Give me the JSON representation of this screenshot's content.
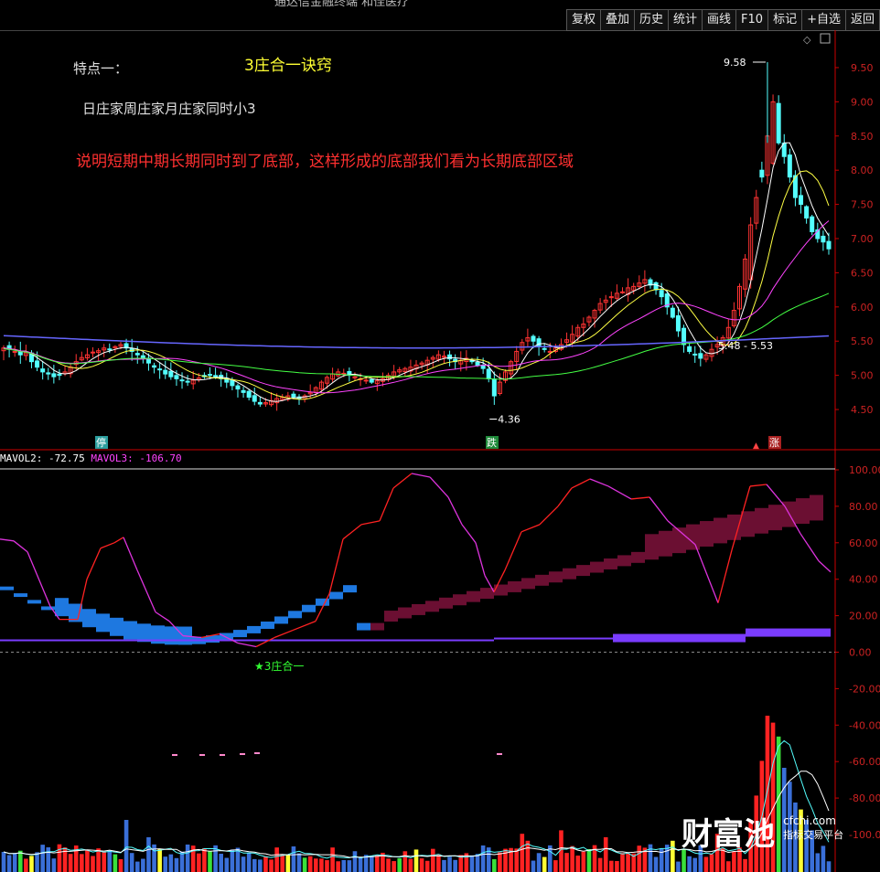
{
  "toolbar": {
    "title": "通达信金融终端 和佳医疗",
    "buttons": [
      "复权",
      "叠加",
      "历史",
      "统计",
      "画线",
      "F10",
      "标记",
      "+自选",
      "返回"
    ]
  },
  "annotations": {
    "feature_label": "特点一：",
    "method_title": "3庄合一诀窍",
    "condition_text": "日庄家周庄家月庄家同时小3",
    "explanation_text": "说明短期中期长期同时到了底部，这样形成的底部我们看为长期底部区域",
    "signal_label": "★3庄合一"
  },
  "price_panel": {
    "high_label": "9.58",
    "low_label": "4.36",
    "range_label": "5.48 - 5.53",
    "markers": [
      "停",
      "跌",
      "涨"
    ]
  },
  "indicator_panel": {
    "legend": [
      {
        "text": "MAVOL2: -72.75",
        "color": "#ffffff"
      },
      {
        "text": "MAVOL3: -106.70",
        "color": "#ff44ff"
      }
    ]
  },
  "watermark": {
    "brand": "财富池",
    "domain": "cfchi.com",
    "tagline": "指标交易平台"
  },
  "colors": {
    "up": "#ff3333",
    "down": "#54ffff",
    "ma5": "#ffffff",
    "ma10": "#ffff44",
    "ma20": "#ff44ff",
    "ma60": "#44ff44",
    "ma120": "#6666ff",
    "axis": "#cc0000",
    "band_low": "#1e78e0",
    "band_high": "#6b0f32",
    "bar_purple": "#7a3cff"
  },
  "chart_data": [
    {
      "type": "candlestick",
      "title": "",
      "ylim": [
        4.3,
        9.7
      ],
      "y_ticks": [
        "9.50",
        "9.00",
        "8.50",
        "8.00",
        "7.50",
        "7.00",
        "6.50",
        "6.00",
        "5.50",
        "5.00",
        "4.50"
      ],
      "close": [
        5.4,
        5.38,
        5.35,
        5.3,
        5.33,
        5.2,
        5.12,
        5.05,
        5.02,
        4.98,
        5.0,
        5.05,
        5.12,
        5.2,
        5.26,
        5.3,
        5.34,
        5.36,
        5.4,
        5.38,
        5.42,
        5.45,
        5.4,
        5.35,
        5.3,
        5.25,
        5.18,
        5.12,
        5.08,
        5.02,
        4.98,
        4.95,
        4.92,
        4.9,
        4.93,
        4.96,
        4.98,
        5.0,
        4.98,
        4.95,
        4.9,
        4.85,
        4.8,
        4.75,
        4.68,
        4.62,
        4.58,
        4.6,
        4.63,
        4.66,
        4.68,
        4.7,
        4.68,
        4.66,
        4.7,
        4.75,
        4.82,
        4.9,
        4.97,
        5.02,
        5.05,
        5.03,
        5.0,
        4.98,
        4.95,
        4.93,
        4.9,
        4.92,
        4.95,
        5.0,
        5.05,
        5.08,
        5.1,
        5.12,
        5.15,
        5.18,
        5.22,
        5.26,
        5.3,
        5.28,
        5.24,
        5.2,
        5.22,
        5.25,
        5.2,
        5.15,
        5.1,
        4.95,
        4.7,
        4.9,
        5.05,
        5.2,
        5.35,
        5.48,
        5.55,
        5.5,
        5.42,
        5.38,
        5.35,
        5.4,
        5.45,
        5.52,
        5.6,
        5.7,
        5.75,
        5.85,
        5.95,
        6.05,
        6.1,
        6.15,
        6.2,
        6.22,
        6.28,
        6.3,
        6.35,
        6.4,
        6.32,
        6.25,
        6.15,
        6.0,
        5.85,
        5.65,
        5.45,
        5.35,
        5.3,
        5.25,
        5.3,
        5.38,
        5.45,
        5.55,
        5.7,
        5.95,
        6.3,
        6.7,
        7.2,
        7.6,
        7.9,
        8.5,
        9.0,
        8.4,
        8.2,
        7.9,
        7.6,
        7.5,
        7.3,
        7.1,
        7.0,
        6.95,
        6.85
      ]
    },
    {
      "type": "line",
      "title": "",
      "ylim": [
        -100,
        100
      ],
      "y_ticks": [
        "100.00",
        "80.00",
        "60.00",
        "40.00",
        "20.00",
        "0.00",
        "-20.00",
        "-40.00",
        "-60.00",
        "-80.00",
        "-100.00"
      ],
      "series": [
        {
          "name": "MAVOL2",
          "value": -72.75
        },
        {
          "name": "MAVOL3",
          "value": -106.7
        }
      ]
    }
  ]
}
